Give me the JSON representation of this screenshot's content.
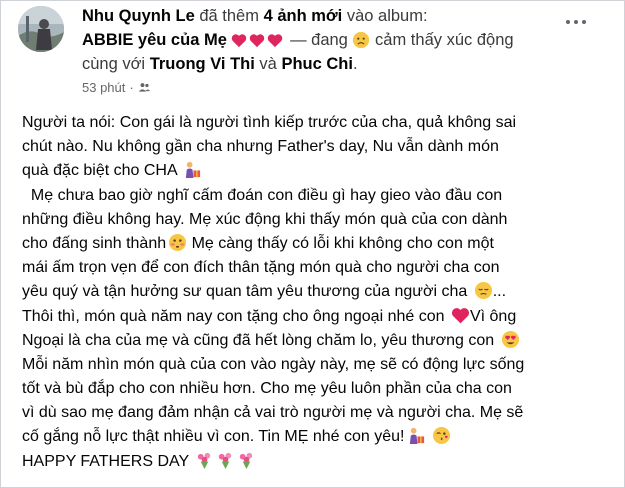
{
  "author": {
    "name": "Nhu Quynh Le",
    "avatar_icon": "profile-photo-icon"
  },
  "header": {
    "action_prefix": "đã thêm",
    "action_count": "4 ảnh mới",
    "action_suffix": "vào album:",
    "album_name": "ABBIE yêu của Mẹ",
    "feeling_prefix": "— đang",
    "feeling_text": "cảm thấy xúc động cùng với",
    "tag_1": "Truong Vi Thi",
    "tag_joiner": "và",
    "tag_2": "Phuc Chi",
    "end_punct": "."
  },
  "meta": {
    "time": "53 phút",
    "separator": "·",
    "privacy_icon": "friends-icon"
  },
  "more_icon": "more-options-icon",
  "post": {
    "lines": [
      "Người ta nói: Con gái là người tình kiếp trước của cha, quả không sai",
      "chút nào. Nu không gần cha nhưng Father's day, Nu vẫn dành món",
      "quà đặc biệt cho CHA",
      "  Mẹ chưa bao giờ nghĩ cấm đoán con điều gì hay gieo vào đầu con",
      "những điều không hay. Mẹ xúc động khi thấy món quà của con dành",
      "cho đấng sinh thành",
      "Mẹ càng thấy có lỗi khi không cho con một",
      "mái ấm trọn vẹn để con đích thân tặng món quà cho người cha con",
      "yêu quý và tận hưởng sư quan tâm yêu thương của người cha",
      "...",
      "Thôi thì, món quà năm nay con tặng cho ông ngoại nhé con",
      "Vì ông",
      "Ngoại là cha của mẹ và cũng đã hết lòng chăm lo, yêu thương con",
      "Mỗi năm nhìn món quà của con vào ngày này, mẹ sẽ có động lực sống",
      "tốt và bù đắp cho con nhiều hơn. Cho mẹ yêu luôn phần của cha con",
      "vì dù sao mẹ đang đảm nhận cả vai trò người mẹ và người cha. Mẹ sẽ",
      "cố gắng nỗ lực thật nhiều vì con. Tin MẸ nhé con yêu!",
      "HAPPY FATHERS DAY"
    ]
  },
  "colors": {
    "heart": "#e0245e",
    "text": "#050505",
    "secondary": "#65676b"
  }
}
